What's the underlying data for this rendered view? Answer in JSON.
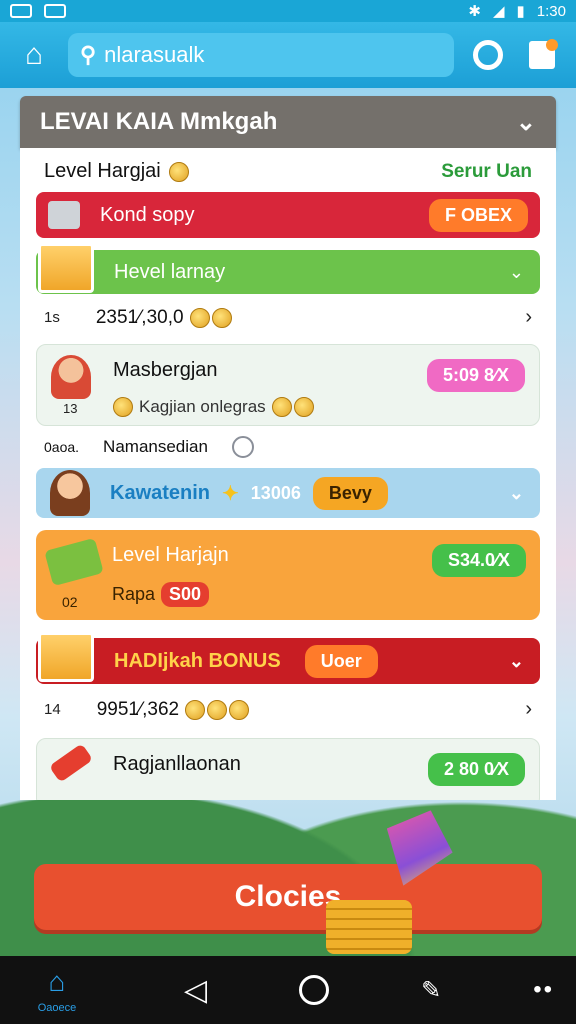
{
  "status_bar": {
    "time": "1:30"
  },
  "app_bar": {
    "search_value": "nlarasualk"
  },
  "panel": {
    "title": "LEVAI KAIA Mmkgah",
    "header_label": "Level Hargjai",
    "header_right": "Serur Uan",
    "red_bar": {
      "label": "Kond sopy",
      "badge": "F OBEX"
    },
    "green_bar": {
      "label": "Hevel larnay"
    },
    "row1": {
      "num": "1s",
      "value": "2351⁄,30,0"
    },
    "card1": {
      "title": "Masbergjan",
      "subtitle": "Kagjian onlegras",
      "num": "13",
      "badge": "5:09 8⁄X"
    },
    "plain_row": {
      "label_small": "0aoa.",
      "label": "Namansedian"
    },
    "blue_bar": {
      "label": "Kawatenin",
      "number": "13006",
      "badge": "Bevy"
    },
    "orange_card": {
      "title": "Level Harjajn",
      "subtitle": "Rapa",
      "badge_num": "S00",
      "num": "02",
      "badge": "S34.0⁄X"
    },
    "bonus_bar": {
      "label": "HADIjkah BONUS",
      "badge": "Uoer"
    },
    "row2": {
      "num": "14",
      "value": "9951⁄,362"
    },
    "last_card": {
      "title": "Ragjanllaonan",
      "badge": "2 80 0⁄X"
    }
  },
  "big_button": {
    "label": "Clocies"
  },
  "nav": {
    "home_label": "Oaoece"
  },
  "colors": {
    "brand_blue": "#1c9fd6",
    "red": "#d8263a",
    "green": "#6cc34b",
    "orange": "#f9a43c",
    "cta": "#e8502f"
  }
}
